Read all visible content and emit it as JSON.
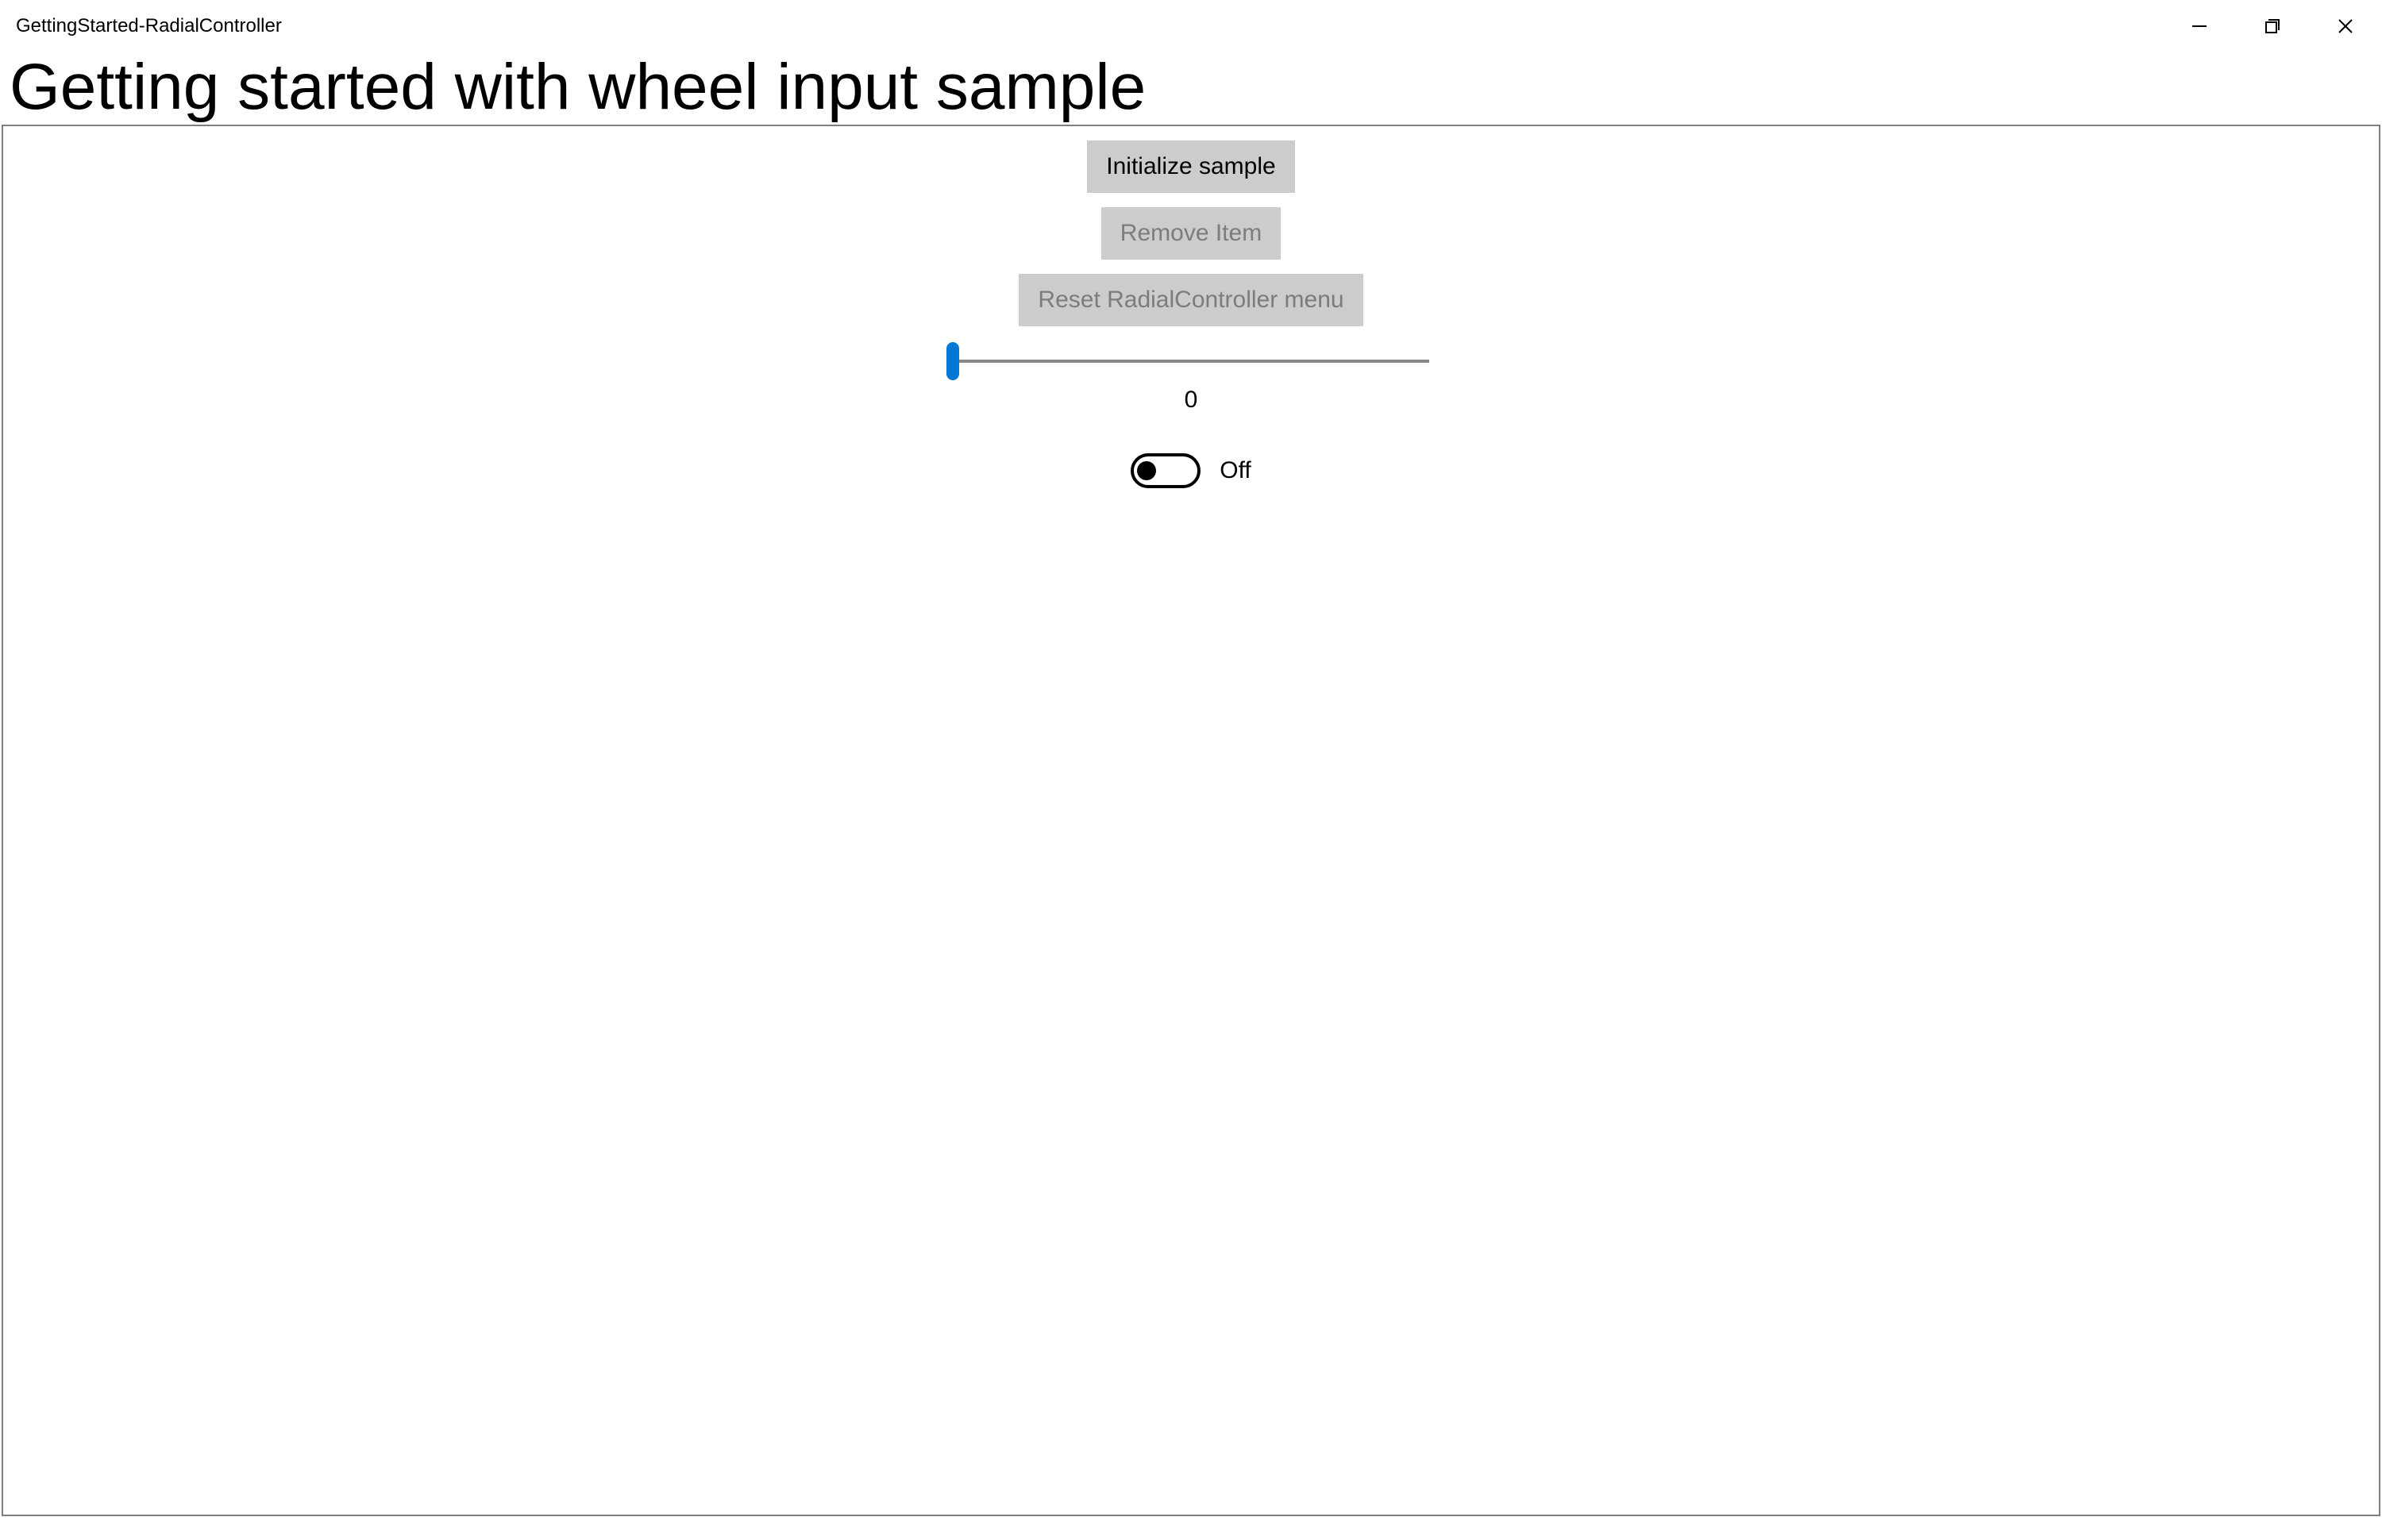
{
  "window": {
    "title": "GettingStarted-RadialController"
  },
  "header": {
    "title": "Getting started with wheel input sample"
  },
  "buttons": {
    "initialize": "Initialize sample",
    "remove": "Remove Item",
    "reset": "Reset RadialController menu"
  },
  "slider": {
    "value": "0"
  },
  "toggle": {
    "state_label": "Off"
  }
}
